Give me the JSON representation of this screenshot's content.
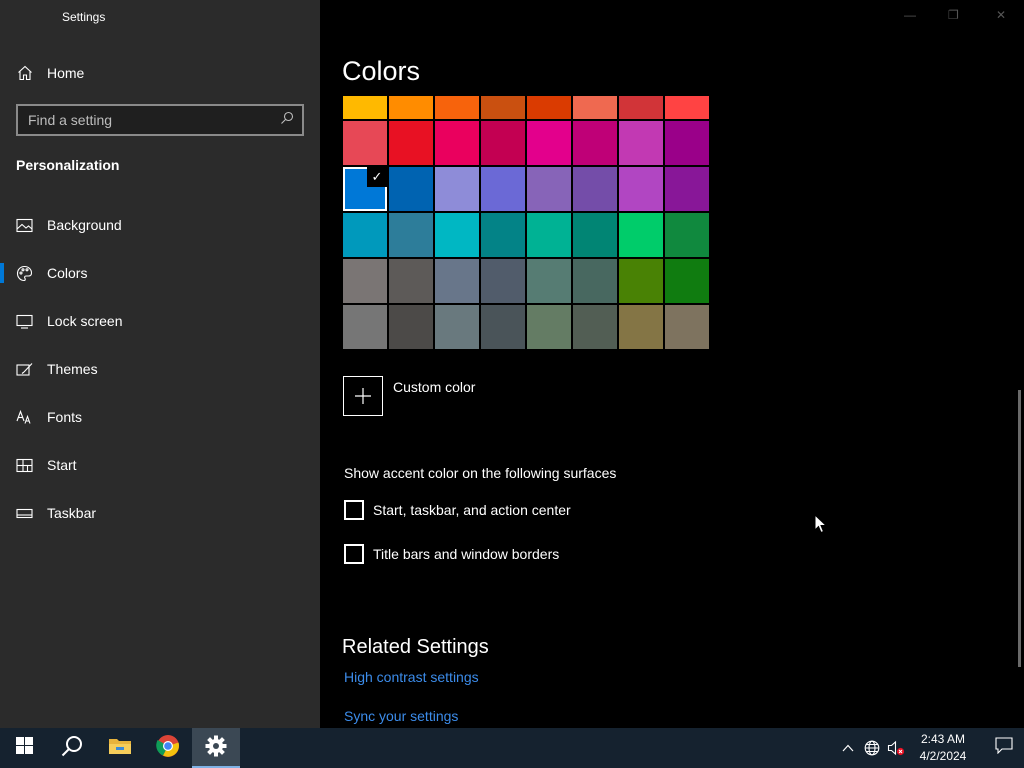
{
  "app": {
    "title": "Settings"
  },
  "sidebar": {
    "home_label": "Home",
    "search_placeholder": "Find a setting",
    "section_title": "Personalization",
    "items": [
      {
        "label": "Background",
        "icon": "picture-icon"
      },
      {
        "label": "Colors",
        "icon": "palette-icon",
        "selected": true
      },
      {
        "label": "Lock screen",
        "icon": "lock-screen-icon"
      },
      {
        "label": "Themes",
        "icon": "brush-icon"
      },
      {
        "label": "Fonts",
        "icon": "fonts-icon"
      },
      {
        "label": "Start",
        "icon": "start-grid-icon"
      },
      {
        "label": "Taskbar",
        "icon": "taskbar-icon"
      }
    ]
  },
  "main": {
    "title": "Colors",
    "swatches": [
      [
        "#ffb900",
        "#ff8c00",
        "#f7630c",
        "#ca5010",
        "#da3b01",
        "#ef6950",
        "#d13438",
        "#ff4343"
      ],
      [
        "#e74856",
        "#e81123",
        "#ea005e",
        "#c30052",
        "#e3008c",
        "#bf0077",
        "#c239b3",
        "#9a0089"
      ],
      [
        "#0078d7",
        "#0063b1",
        "#8e8cd8",
        "#6b69d6",
        "#8764b8",
        "#744da9",
        "#b146c2",
        "#881798"
      ],
      [
        "#0099bc",
        "#2d7d9a",
        "#00b7c3",
        "#038387",
        "#00b294",
        "#018574",
        "#00cc6a",
        "#10893e"
      ],
      [
        "#7a7574",
        "#5d5a58",
        "#68768a",
        "#515c6b",
        "#567c73",
        "#486860",
        "#498205",
        "#107c10"
      ],
      [
        "#767676",
        "#4c4a48",
        "#69797e",
        "#4a5459",
        "#647c64",
        "#525e54",
        "#847545",
        "#7e735f"
      ]
    ],
    "selected_color": "#0078d7",
    "custom_color_label": "Custom color",
    "accent_heading": "Show accent color on the following surfaces",
    "checkboxes": [
      {
        "label": "Start, taskbar, and action center",
        "checked": false
      },
      {
        "label": "Title bars and window borders",
        "checked": false
      }
    ],
    "related_title": "Related Settings",
    "links": [
      "High contrast settings",
      "Sync your settings"
    ]
  },
  "taskbar": {
    "apps": [
      "start-icon",
      "search-icon",
      "file-explorer-icon",
      "chrome-icon",
      "settings-gear-icon"
    ],
    "time": "2:43 AM",
    "date": "4/2/2024"
  },
  "colors": {
    "accent": "#0078d7",
    "link": "#3c8cea",
    "sidebar_bg": "#2b2b2b",
    "taskbar_bg": "#15222f"
  }
}
